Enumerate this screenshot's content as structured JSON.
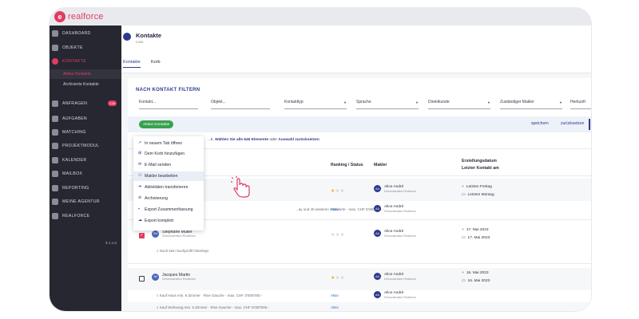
{
  "app": {
    "logo_letter": "e",
    "logo_text": "realforce"
  },
  "sidebar": {
    "items": [
      {
        "label": "DASHBOARD",
        "icon": "dashboard-icon"
      },
      {
        "label": "OBJEKTE",
        "icon": "building-icon"
      },
      {
        "label": "KONTAKTE",
        "icon": "contacts-icon",
        "active": true
      },
      {
        "label": "ANFRAGEN",
        "icon": "inbox-icon",
        "badge": "138"
      },
      {
        "label": "AUFGABEN",
        "icon": "tasks-icon"
      },
      {
        "label": "MATCHING",
        "icon": "matching-icon"
      },
      {
        "label": "PROJEKTMODUL",
        "icon": "project-icon"
      },
      {
        "label": "KALENDER",
        "icon": "calendar-icon"
      },
      {
        "label": "MAILBOX",
        "icon": "mail-icon"
      },
      {
        "label": "REPORTING",
        "icon": "report-icon"
      },
      {
        "label": "MEINE AGENTUR",
        "icon": "agency-icon"
      },
      {
        "label": "REALFORCE",
        "icon": "globe-icon"
      }
    ],
    "sub_items": [
      "Aktive Kontakte",
      "Archivierte Kontakte"
    ],
    "footer": "€ 1.1.0"
  },
  "header": {
    "title": "Kontakte",
    "subtitle": "Liste",
    "tabs": [
      "Kontakte",
      "Korb"
    ]
  },
  "filter": {
    "title": "NACH KONTAKT FILTERN",
    "fields": [
      "Kontakt...",
      "Objekt...",
      "Kontakttyp",
      "Sprache",
      "Direktkunde",
      "Zuständiger Makler",
      "Herkunft"
    ]
  },
  "actions": {
    "active_label": "Aktive Kontakte",
    "save": "speichern",
    "reset": "zurücksetzen"
  },
  "selection": {
    "prefix": "...k.",
    "select_all": "Wählen Sie alle 646 Elemente",
    "middle": "oder",
    "reset": "Auswahl zurücksetzen"
  },
  "table": {
    "headers": {
      "ranking": "Ranking / Status",
      "makler": "Makler",
      "created": "Erstellungsdatum",
      "last_contact": "Letzter Kontakt am"
    },
    "maker_name": "Alice André",
    "maker_sub": "Démonstration Realforce",
    "rows": [
      {
        "stars": 1,
        "date1": "Letzten Freitag",
        "date2": "Letzten Montag"
      },
      {
        "search": "...ay und 40 weiteren Standorte · max. CHF 5'000'000.-",
        "status": "Aktiv"
      },
      {
        "name": "Stéphane Muller",
        "sub": "Démonstration Realforce",
        "initials": "SM",
        "stars": 0,
        "date1": "17. Mai 2023",
        "date2": "17. Mai 2023",
        "search": "Noch kein Suchprofil hinterlegt"
      },
      {
        "name": "Jacques Martin",
        "sub": "Démonstration Realforce",
        "initials": "JM",
        "stars": 1,
        "date1": "16. Mai 2023",
        "date2": "16. Mai 2023"
      },
      {
        "search": "Kauf Haus min. 6 Zimmer · Rive Gauche · max. CHF 3'000'000.-",
        "status": "Aktiv"
      },
      {
        "search": "Kauf Wohnung min. 6 Zimmer · Rive Gauche · max. CHF 5'000'000.-",
        "status": "Aktiv"
      }
    ]
  },
  "context_menu": {
    "items": [
      {
        "label": "In neuem Tab öffnen",
        "icon": "external-link-icon"
      },
      {
        "label": "Dem Korb hinzufügen",
        "icon": "basket-icon"
      },
      {
        "label": "E-Mail senden",
        "icon": "email-icon"
      },
      {
        "label": "Makler bearbeiten",
        "icon": "users-icon",
        "highlighted": true
      },
      {
        "label": "Aktivitäten transferieren",
        "icon": "transfer-icon"
      },
      {
        "label": "Archivierung",
        "icon": "archive-icon"
      },
      {
        "label": "Export Zusammenfassung",
        "icon": "export-icon"
      },
      {
        "label": "Export komplett",
        "icon": "cloud-export-icon"
      }
    ]
  },
  "colors": {
    "brand": "#e23b63",
    "primary": "#2d3a8c",
    "sidebar": "#262730",
    "success": "#37a24d",
    "star": "#f2b21b"
  }
}
